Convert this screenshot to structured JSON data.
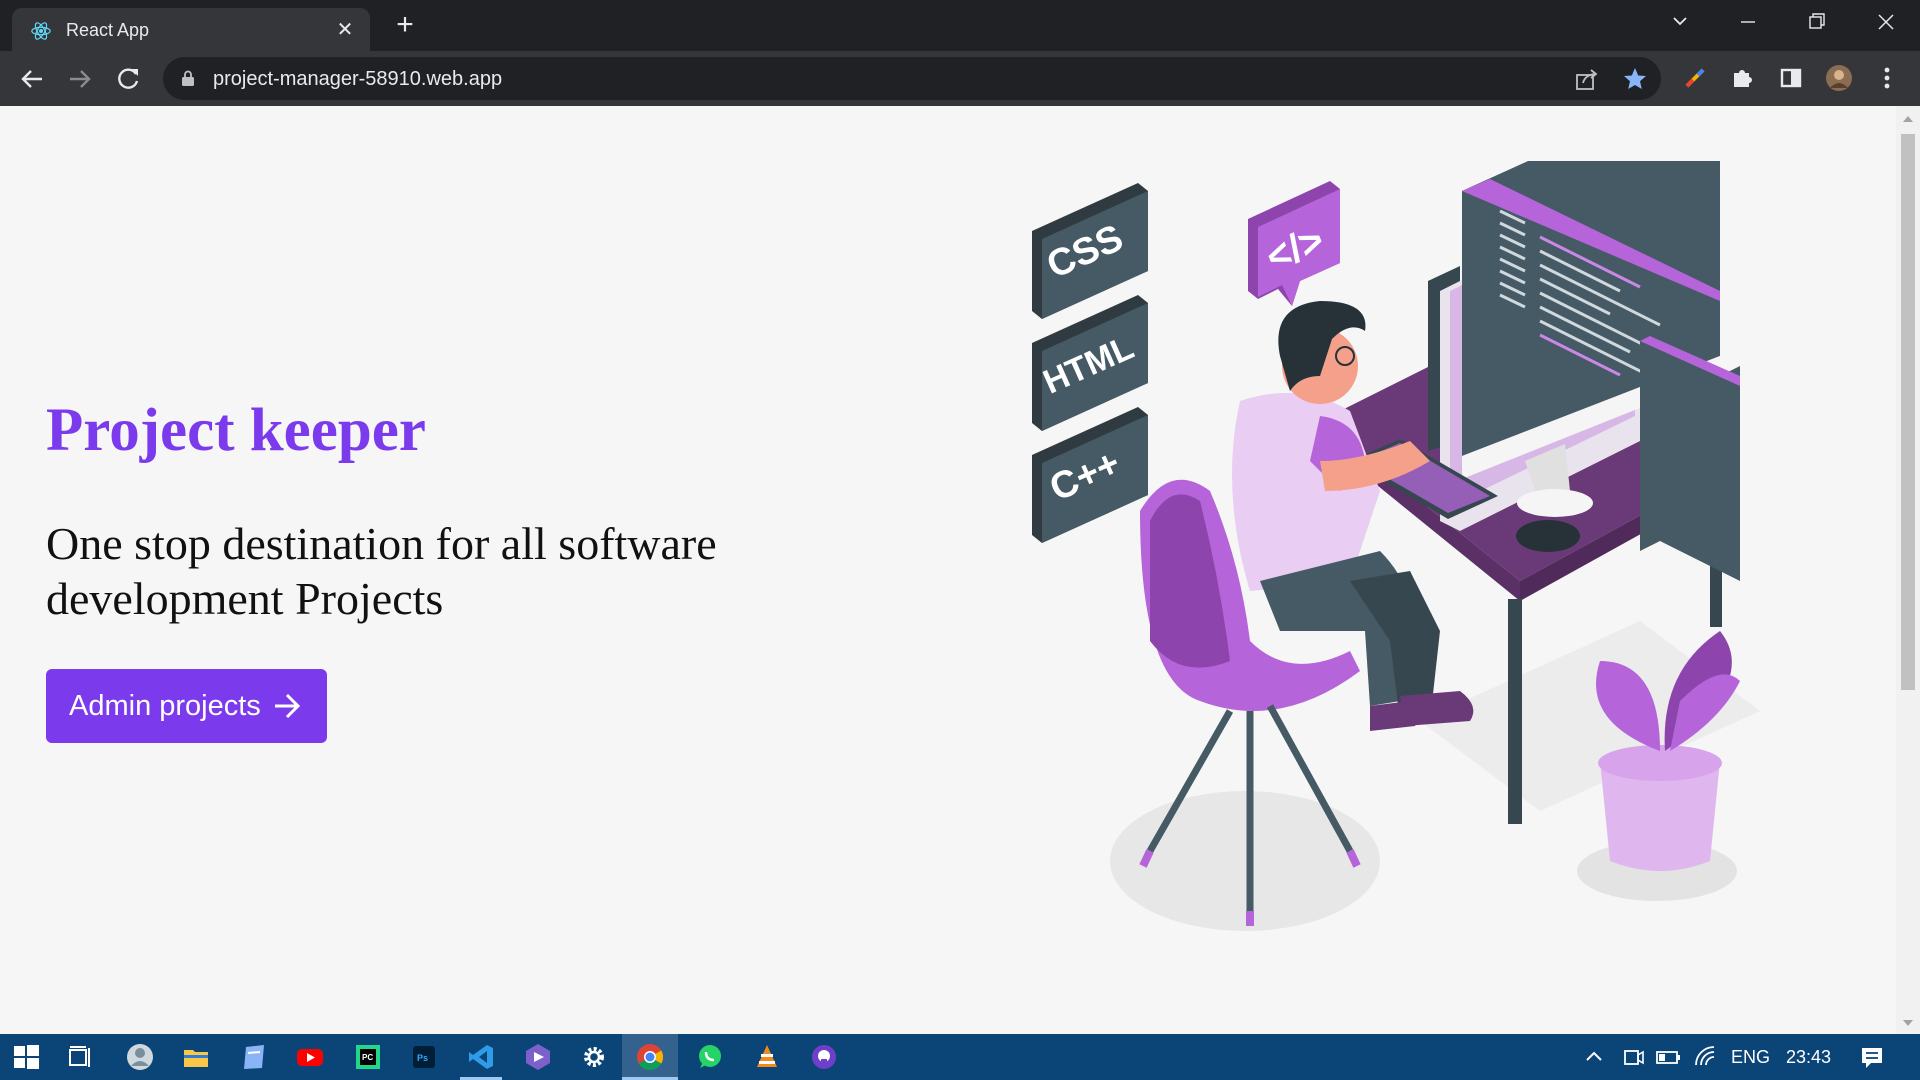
{
  "browser": {
    "tab_title": "React App",
    "url": "project-manager-58910.web.app",
    "tab_close": "✕",
    "new_tab": "+"
  },
  "hero": {
    "title": "Project keeper",
    "subtitle": "One stop destination for all software development Projects",
    "button_label": "Admin projects"
  },
  "illustration": {
    "tags": [
      "CSS",
      "HTML",
      "C++"
    ],
    "code_bubble": "</>"
  },
  "taskbar": {
    "language": "ENG",
    "time": "23:43"
  },
  "colors": {
    "accent": "#7c3aed",
    "illustration_purple": "#a85fc8",
    "desk": "#6a3a78"
  }
}
